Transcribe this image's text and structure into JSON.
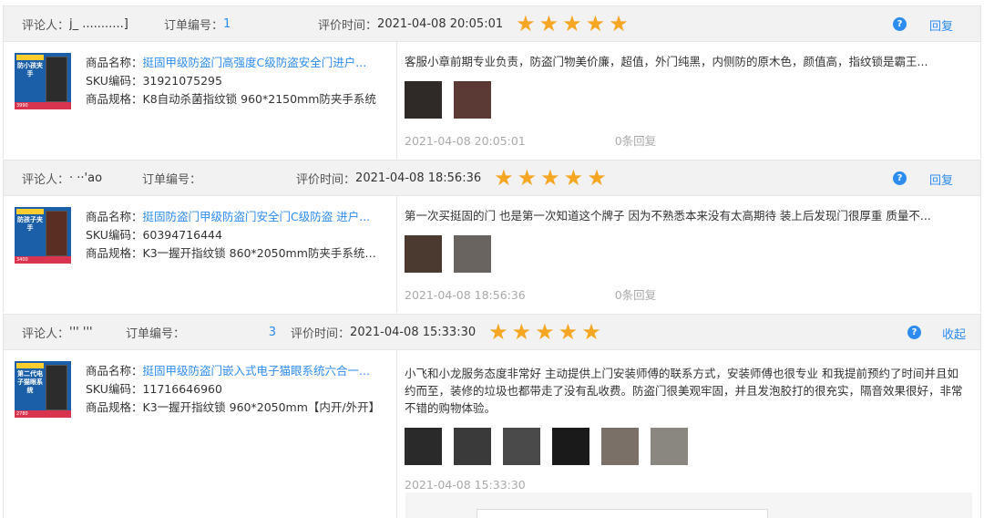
{
  "labels": {
    "reviewer": "评论人：",
    "order_no": "订单编号：",
    "review_time": "评价时间：",
    "product_name": "商品名称：",
    "sku": "SKU编码：",
    "spec": "商品规格："
  },
  "reviews": [
    {
      "reviewer": "j_ ...........]",
      "order_no": "1",
      "time": "2021-04-08 20:05:01",
      "stars": 5,
      "action": "回复",
      "product_name": "挺固甲级防盗门高强度C级防盗安全门进户...",
      "sku": "31921075295",
      "spec": "K8自动杀菌指纹锁 960*2150mm防夹手系统",
      "thumb_text": "防小孩夹手",
      "thumb_price": "3990",
      "text": "客服小章前期专业负责，防盗门物美价廉，超值，外门纯黑，内侧防的原木色，颜值高，指纹锁是霸王...",
      "photo_colors": [
        "#2f2a27",
        "#5b3a36"
      ],
      "date": "2021-04-08 20:05:01",
      "reply_count": "0条回复"
    },
    {
      "reviewer": "·  ··'ao",
      "order_no": "",
      "time": "2021-04-08 18:56:36",
      "stars": 5,
      "action": "回复",
      "product_name": "挺固防盗门甲级防盗门安全门C级防盗 进户...",
      "sku": "60394716444",
      "spec": "K3一握开指纹锁 860*2050mm防夹手系统【...",
      "thumb_text": "防孩子夹手",
      "thumb_price": "3400",
      "text": "第一次买挺固的门 也是第一次知道这个牌子 因为不熟悉本来没有太高期待 装上后发现门很厚重 质量不...",
      "photo_colors": [
        "#4a3a30",
        "#6a6460"
      ],
      "date": "2021-04-08 18:56:36",
      "reply_count": "0条回复"
    },
    {
      "reviewer": "''' '''",
      "order_no": "3",
      "time": "2021-04-08 15:33:30",
      "stars": 5,
      "action": "收起",
      "product_name": "挺固甲级防盗门嵌入式电子猫眼系统六合一...",
      "sku": "11716646960",
      "spec": "K3一握开指纹锁 960*2050mm【内开/外开】",
      "thumb_text": "第二代电子猫眼系统",
      "thumb_price": "2780",
      "text": "小飞和小龙服务态度非常好 主动提供上门安装师傅的联系方式，安装师傅也很专业 和我提前预约了时间并且如约而至，装修的垃圾也都带走了没有乱收费。防盗门很美观牢固，并且发泡胶打的很充实，隔音效果很好，非常不错的购物体验。",
      "photo_colors": [
        "#2a2a2a",
        "#3a3a3a",
        "#4a4a4a",
        "#1a1a1a",
        "#7a7068",
        "#8a8680"
      ],
      "date": "2021-04-08 15:33:30",
      "reply_count": ""
    }
  ],
  "colors": {
    "accent": "#2d8cf0",
    "star": "#f5a623",
    "header_bg": "#f2f2f2"
  },
  "icons": {
    "help": "question-circle-icon",
    "star": "star-icon"
  }
}
